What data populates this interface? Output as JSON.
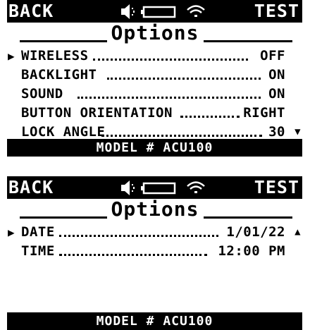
{
  "screens": [
    {
      "header": {
        "back_label": "BACK",
        "test_label": "TEST",
        "icons": [
          "speaker-icon",
          "battery-icon",
          "wifi-icon"
        ]
      },
      "title": "Options",
      "items": [
        {
          "label": "WIRELESS",
          "value": "OFF",
          "selected": true
        },
        {
          "label": "BACKLIGHT",
          "value": "ON"
        },
        {
          "label": "SOUND",
          "value": "ON"
        },
        {
          "label": "BUTTON ORIENTATION",
          "value": "RIGHT"
        },
        {
          "label": "LOCK ANGLE",
          "value": "30"
        }
      ],
      "cursor_glyph": "▶",
      "scroll_glyph": "▼",
      "footer": "MODEL # ACU100"
    },
    {
      "header": {
        "back_label": "BACK",
        "test_label": "TEST",
        "icons": [
          "speaker-icon",
          "battery-icon",
          "wifi-icon"
        ]
      },
      "title": "Options",
      "items": [
        {
          "label": "DATE",
          "value": "1/01/22",
          "selected": true
        },
        {
          "label": "TIME",
          "value": "12:00 PM"
        }
      ],
      "cursor_glyph": "▶",
      "scroll_glyph": "▲",
      "footer": "MODEL # ACU100"
    }
  ],
  "colors": {
    "screen_bg": "#ffffff",
    "bar_bg": "#000000",
    "bar_text": "#ffffff",
    "text": "#000000"
  }
}
